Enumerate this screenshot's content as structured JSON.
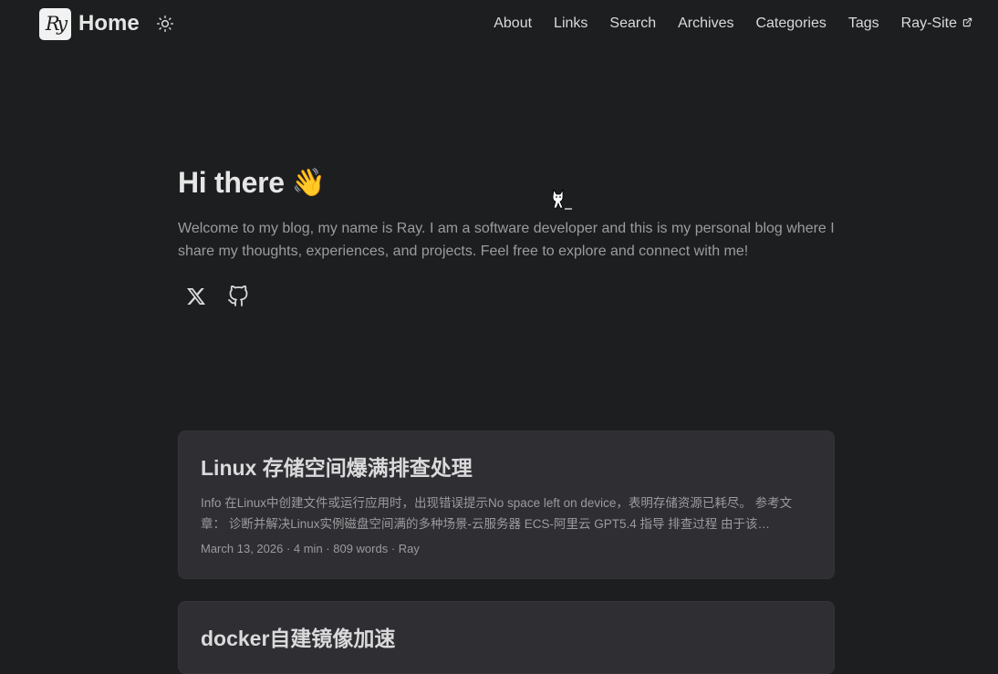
{
  "header": {
    "logo_text": "Ry",
    "home_label": "Home",
    "nav": [
      {
        "label": "About"
      },
      {
        "label": "Links"
      },
      {
        "label": "Search"
      },
      {
        "label": "Archives"
      },
      {
        "label": "Categories"
      },
      {
        "label": "Tags"
      },
      {
        "label": "Ray-Site",
        "external": true
      }
    ]
  },
  "hero": {
    "title": "Hi there",
    "emoji": "👋",
    "text": "Welcome to my blog, my name is Ray. I am a software developer and this is my personal blog where I share my thoughts, experiences, and projects. Feel free to explore and connect with me!",
    "social": [
      {
        "icon": "x-icon"
      },
      {
        "icon": "github-icon"
      }
    ]
  },
  "posts": [
    {
      "title": "Linux 存储空间爆满排查处理",
      "summary": "Info 在Linux中创建文件或运行应用时，出现错误提示No space left on device，表明存储资源已耗尽。 参考文章： 诊断并解决Linux实例磁盘空间满的多种场景-云服务器 ECS-阿里云 GPT5.4 指导 排查过程 由于该…",
      "meta": "March 13, 2026 · 4 min · 809 words · Ray"
    },
    {
      "title": "docker自建镜像加速"
    }
  ],
  "colors": {
    "background": "#1d1e20",
    "card": "#2e2e33",
    "text": "#dadadb",
    "secondary": "#9b9c9d"
  }
}
